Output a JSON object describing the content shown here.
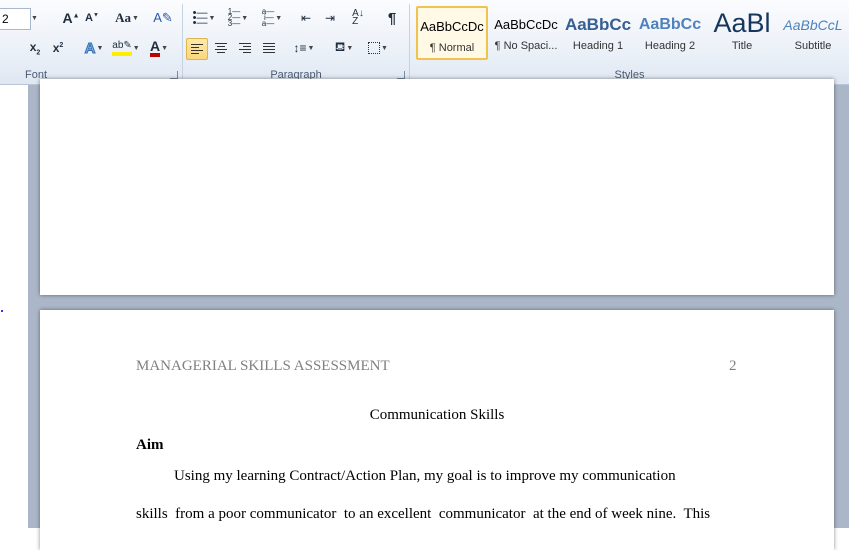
{
  "ribbon": {
    "font_group": {
      "label": "Font",
      "size_value": "2"
    },
    "paragraph_group": {
      "label": "Paragraph"
    },
    "styles_group": {
      "label": "Styles",
      "items": [
        {
          "sample": "AaBbCcDc",
          "name": "¶ Normal",
          "selected": true
        },
        {
          "sample": "AaBbCcDc",
          "name": "¶ No Spaci...",
          "selected": false
        },
        {
          "sample": "AaBbCc",
          "name": "Heading 1",
          "selected": false
        },
        {
          "sample": "AaBbCc",
          "name": "Heading 2",
          "selected": false
        },
        {
          "sample": "AaBl",
          "name": "Title",
          "selected": false
        },
        {
          "sample": "AaBbCcL",
          "name": "Subtitle",
          "selected": false
        }
      ]
    }
  },
  "document": {
    "page2": {
      "header_left": "MANAGERIAL SKILLS ASSESSMENT",
      "page_number": "2",
      "title": "Communication Skills",
      "heading": "Aim",
      "para_line1": "Using my learning Contract/Action Plan, my goal is to improve my communication",
      "para_line2": "skills  from a poor communicator  to an excellent  communicator  at the end of week nine.  This"
    }
  },
  "colors": {
    "doc_background": "#abb7c8",
    "heading_blue": "#17365d",
    "accent_highlight": "#fbd77c",
    "font_color_red": "#c00000"
  }
}
